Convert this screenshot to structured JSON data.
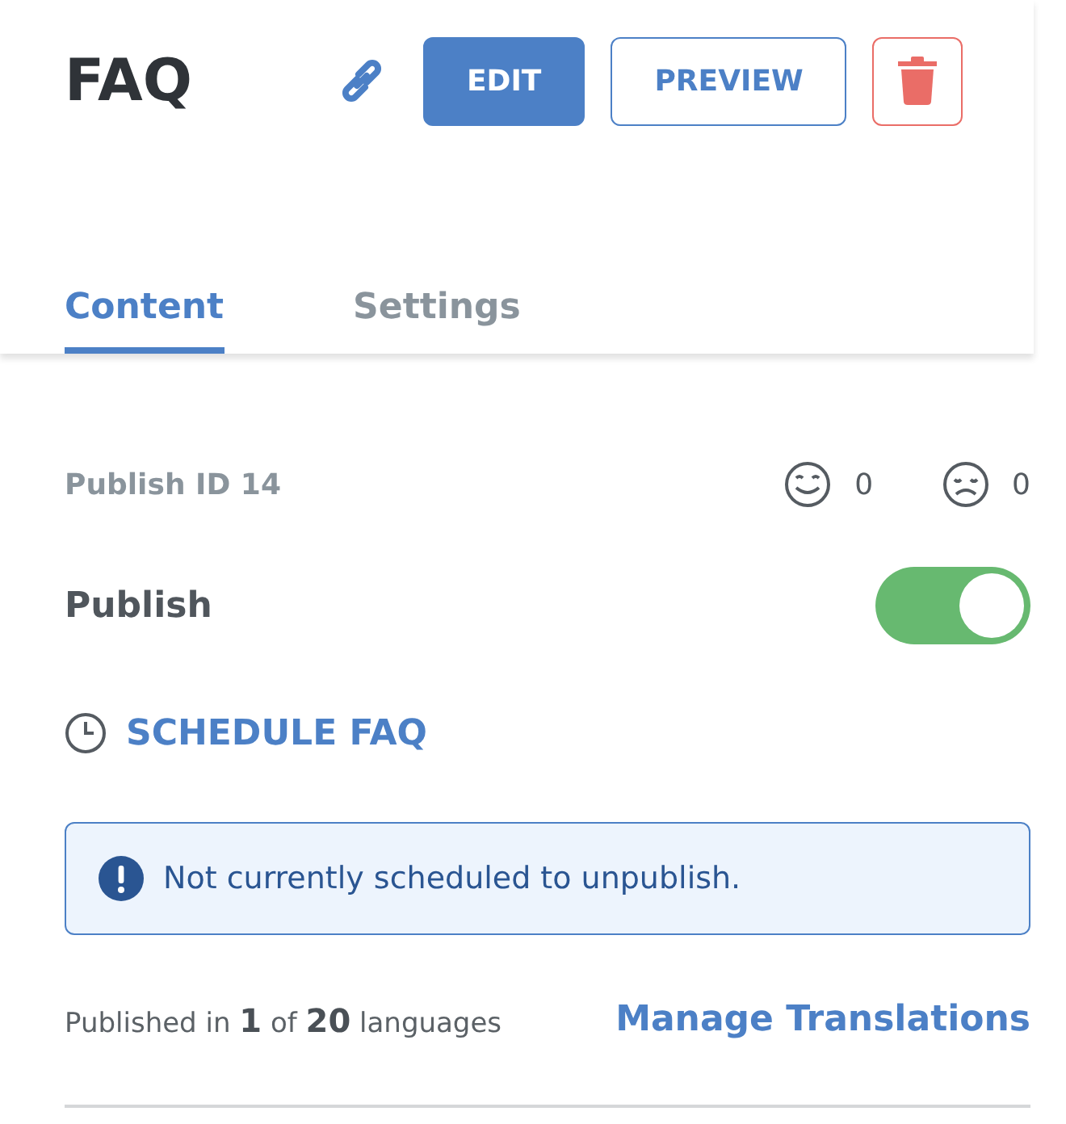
{
  "title": "FAQ",
  "actions": [
    {
      "kind": "link"
    },
    {
      "kind": "primary",
      "label": "EDIT"
    },
    {
      "kind": "outline",
      "label": "PREVIEW"
    },
    {
      "kind": "delete"
    }
  ],
  "tabs": [
    {
      "label": "Content",
      "selected": true
    },
    {
      "label": "Settings",
      "selected": false
    }
  ],
  "publish_id": "Publish ID 14",
  "reactions": [
    {
      "kind": "happy",
      "count": "0"
    },
    {
      "kind": "sad",
      "count": "0"
    }
  ],
  "publish": {
    "label": "Publish",
    "on": true
  },
  "schedule_link": "SCHEDULE FAQ",
  "notice": "Not currently scheduled to unpublish.",
  "languages": "Published in **1** of **20** languages",
  "manage_link": "Manage Translations"
}
